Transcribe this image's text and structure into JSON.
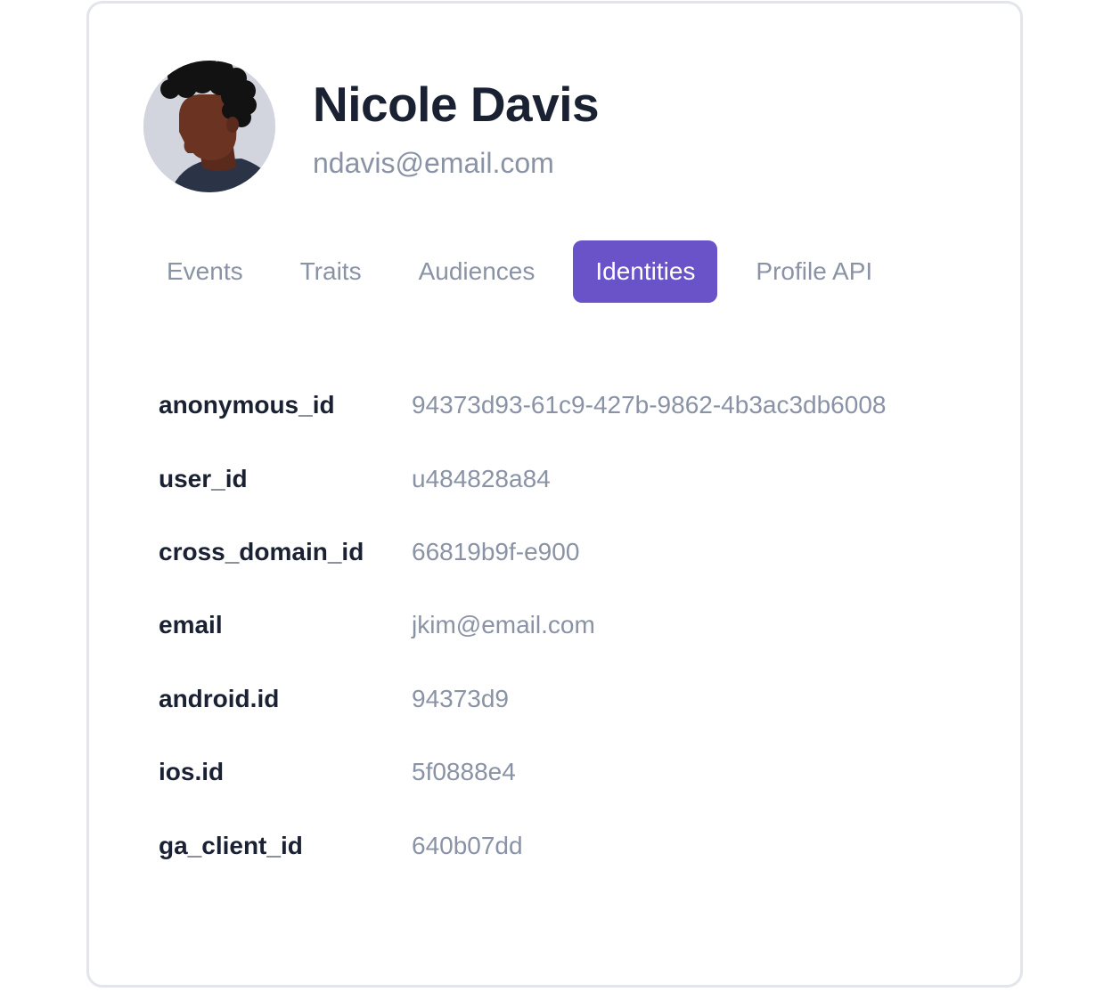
{
  "profile": {
    "name": "Nicole Davis",
    "email": "ndavis@email.com"
  },
  "tabs": [
    {
      "label": "Events",
      "active": false
    },
    {
      "label": "Traits",
      "active": false
    },
    {
      "label": "Audiences",
      "active": false
    },
    {
      "label": "Identities",
      "active": true
    },
    {
      "label": "Profile API",
      "active": false
    }
  ],
  "identities": [
    {
      "key": "anonymous_id",
      "value": "94373d93-61c9-427b-9862-4b3ac3db6008"
    },
    {
      "key": "user_id",
      "value": "u484828a84"
    },
    {
      "key": "cross_domain_id",
      "value": "66819b9f-e900"
    },
    {
      "key": "email",
      "value": "jkim@email.com"
    },
    {
      "key": "android.id",
      "value": "94373d9"
    },
    {
      "key": "ios.id",
      "value": "5f0888e4"
    },
    {
      "key": "ga_client_id",
      "value": "640b07dd"
    }
  ],
  "colors": {
    "accent": "#6a52c8",
    "heading": "#1a2133",
    "muted": "#8a92a6",
    "border": "#e3e5ec",
    "avatar_bg": "#d3d5de"
  }
}
